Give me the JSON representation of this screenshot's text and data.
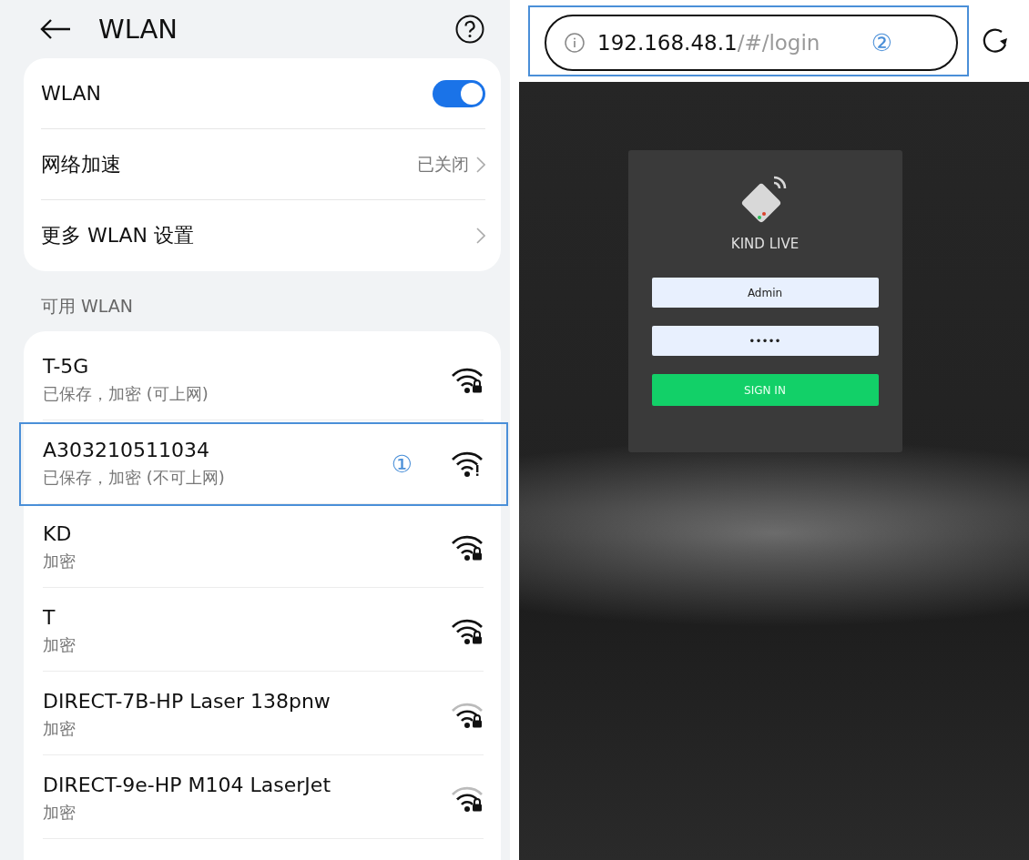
{
  "settings": {
    "title": "WLAN",
    "wlan_toggle": {
      "label": "WLAN",
      "on": true
    },
    "options": [
      {
        "label": "网络加速",
        "value": "已关闭"
      },
      {
        "label": "更多 WLAN 设置"
      }
    ],
    "section_label": "可用 WLAN",
    "networks": [
      {
        "name": "T-5G",
        "status": "已保存，加密 (可上网)",
        "kind": "lock",
        "weak": false,
        "highlighted": false
      },
      {
        "name": "A303210511034",
        "status": "已保存，加密 (不可上网)",
        "kind": "warning",
        "weak": false,
        "highlighted": true,
        "marker": "①"
      },
      {
        "name": "KD",
        "status": "加密",
        "kind": "lock",
        "weak": false,
        "highlighted": false
      },
      {
        "name": "T",
        "status": "加密",
        "kind": "lock",
        "weak": false,
        "highlighted": false
      },
      {
        "name": "DIRECT-7B-HP Laser 138pnw",
        "status": "加密",
        "kind": "lock",
        "weak": true,
        "highlighted": false
      },
      {
        "name": "DIRECT-9e-HP M104 LaserJet",
        "status": "加密",
        "kind": "lock",
        "weak": true,
        "highlighted": false
      }
    ]
  },
  "browser": {
    "url_host": "192.168.48.1",
    "url_path": "/#/login",
    "highlighted": true,
    "marker": "②",
    "login": {
      "brand": "KIND LIVE",
      "username": "Admin",
      "password": "•••••",
      "button": "SIGN IN"
    }
  }
}
